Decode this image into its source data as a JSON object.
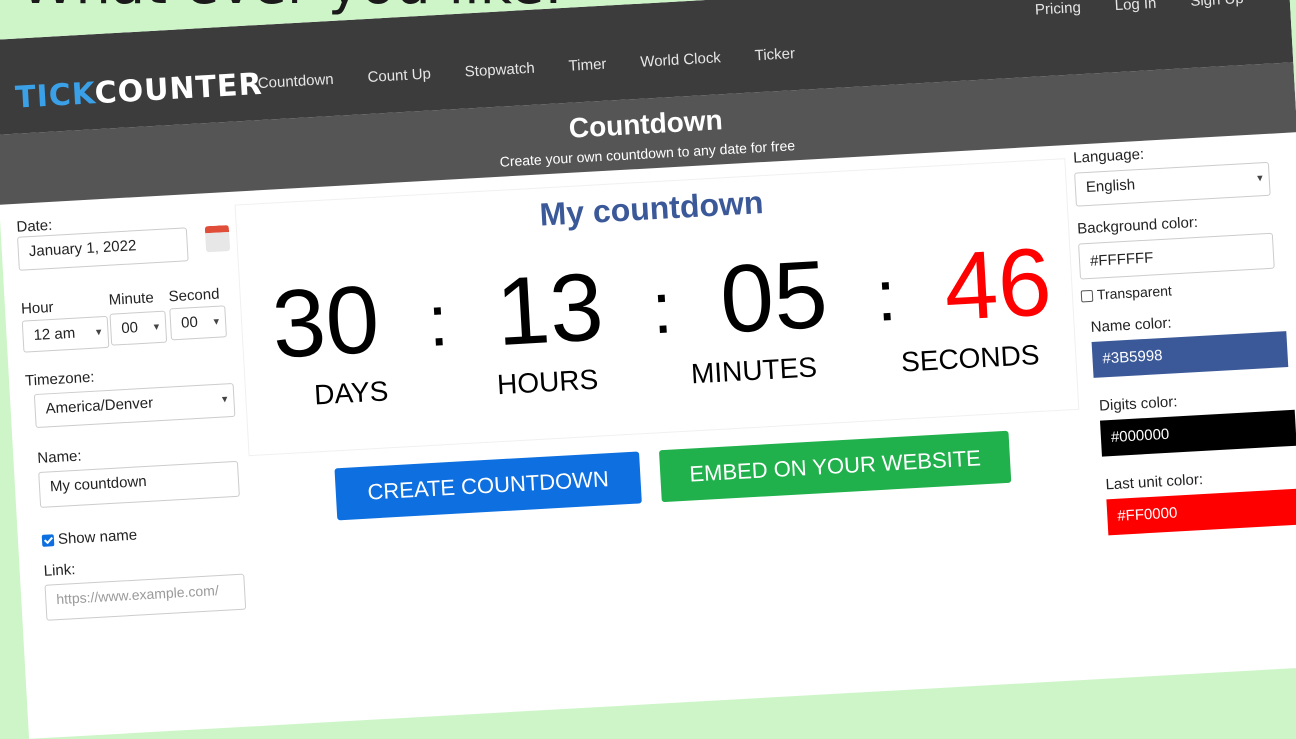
{
  "caption": "What ever you like.",
  "nav": {
    "logo_tick": "TICK",
    "logo_counter": "CUNTER",
    "logo_glyph": "O",
    "items": [
      "Countdown",
      "Count Up",
      "Stopwatch",
      "Timer",
      "World Clock",
      "Ticker"
    ],
    "auth": [
      "Pricing",
      "Log In",
      "Sign Up"
    ]
  },
  "hero": {
    "title": "Countdown",
    "subtitle": "Create your own countdown to any date for free"
  },
  "form": {
    "date_label": "Date:",
    "date_value": "January 1, 2022",
    "hour_label": "Hour",
    "minute_label": "Minute",
    "second_label": "Second",
    "hour_value": "12 am",
    "minute_value": "00",
    "second_value": "00",
    "timezone_label": "Timezone:",
    "timezone_value": "America/Denver",
    "name_label": "Name:",
    "name_value": "My countdown",
    "show_name_label": "Show name",
    "link_label": "Link:",
    "link_placeholder": "https://www.example.com/"
  },
  "preview": {
    "name": "My countdown",
    "days": "30",
    "hours": "13",
    "minutes": "05",
    "seconds": "46",
    "colon": ":",
    "unit_days": "DAYS",
    "unit_hours": "HOURS",
    "unit_minutes": "MINUTES",
    "unit_seconds": "SECONDS"
  },
  "buttons": {
    "create": "CREATE COUNTDOWN",
    "embed": "EMBED ON YOUR WEBSITE"
  },
  "settings": {
    "language_label": "Language:",
    "language_value": "English",
    "bg_label": "Background color:",
    "bg_value": "#FFFFFF",
    "transparent_label": "Transparent",
    "name_color_label": "Name color:",
    "name_color_value": "#3B5998",
    "digits_color_label": "Digits color:",
    "digits_color_value": "#000000",
    "last_unit_label": "Last unit color:",
    "last_unit_value": "#FF0000"
  },
  "colors": {
    "brand_blue": "#3aa0e8",
    "topbar": "#3c3c3c",
    "hero": "#555555",
    "create_btn": "#0d6fe0",
    "embed_btn": "#20b04c",
    "name_color": "#3B5998",
    "digits_color": "#000000",
    "last_unit_color": "#FF0000"
  }
}
